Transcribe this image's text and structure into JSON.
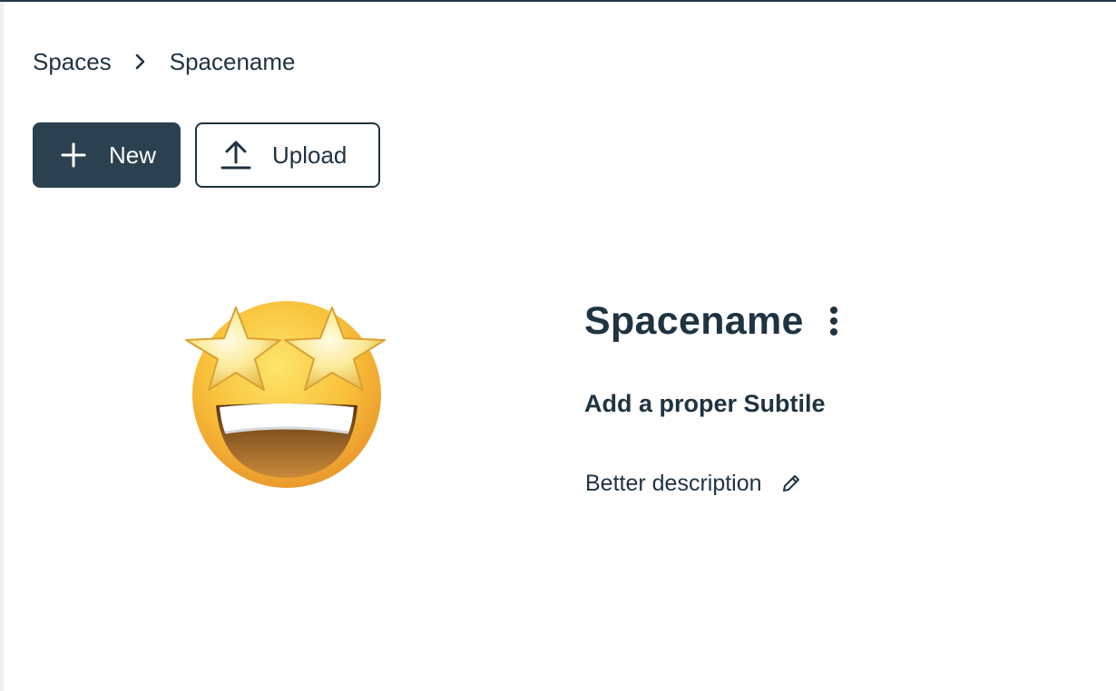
{
  "breadcrumb": {
    "items": [
      {
        "label": "Spaces"
      },
      {
        "label": "Spacename"
      }
    ],
    "separator_icon": "chevron-right-icon"
  },
  "toolbar": {
    "new_label": "New",
    "new_icon": "plus-icon",
    "upload_label": "Upload",
    "upload_icon": "upload-icon"
  },
  "space": {
    "emoji_icon": "star-struck-emoji",
    "title": "Spacename",
    "menu_icon": "kebab-menu-icon",
    "subtitle": "Add a proper Subtile",
    "description": "Better description",
    "edit_icon": "pencil-icon"
  },
  "colors": {
    "primary": "#2b4150",
    "text": "#1f3341",
    "background": "#ffffff"
  }
}
